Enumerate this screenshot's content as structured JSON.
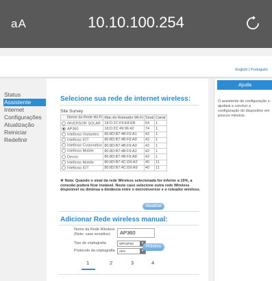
{
  "browser": {
    "text_size_label": "aA",
    "url": "10.10.100.254"
  },
  "lang_links": "English | Português",
  "nav": {
    "items": [
      {
        "label": "Status",
        "active": false
      },
      {
        "label": "Assistente",
        "active": true
      },
      {
        "label": "Internet",
        "active": false
      },
      {
        "label": "Configurações",
        "active": false
      },
      {
        "label": "Atualização",
        "active": false
      },
      {
        "label": "Reiniciar",
        "active": false
      },
      {
        "label": "Redefinir",
        "active": false
      }
    ]
  },
  "wizard": {
    "title": "Selecione sua rede de internet wireless:",
    "site_survey_label": "Site Survey",
    "table": {
      "headers": [
        "Nome da Rede Wi-Fi",
        "Mac do Roteador Wi-Fi",
        "Sinal",
        "Canal"
      ],
      "rows": [
        {
          "ssid": "INVERSOR SOLAR",
          "mac": "18:D:2C:F9:E8:EB",
          "signal": "64",
          "channel": "1",
          "selected": false
        },
        {
          "ssid": "AP360",
          "mac": "18:D:2C:49:96:42",
          "signal": "74",
          "channel": "1",
          "selected": true
        },
        {
          "ssid": "Intelbras Visitantes",
          "mac": "80:8D:B7:4B:F9:A1",
          "signal": "42",
          "channel": "1",
          "selected": false
        },
        {
          "ssid": "Intelbras IOT",
          "mac": "80:8D:B7:4B:F9:A9",
          "signal": "42",
          "channel": "1",
          "selected": false
        },
        {
          "ssid": "Intelbras Corporativo",
          "mac": "80:8D:B7:4B:F9:A0",
          "signal": "42",
          "channel": "1",
          "selected": false
        },
        {
          "ssid": "Intelbras Mobile",
          "mac": "80:8D:B7:4B:F9:A2",
          "signal": "42",
          "channel": "1",
          "selected": false
        },
        {
          "ssid": "Devon",
          "mac": "80:8D:B7:4B:F9:A8",
          "signal": "42",
          "channel": "1",
          "selected": false
        },
        {
          "ssid": "Intelbras Mobile",
          "mac": "80:8D:B7:4C:D9:A2",
          "signal": "40",
          "channel": "11",
          "selected": false
        },
        {
          "ssid": "Intelbras IOT",
          "mac": "80:8D:B7:4C:D9:A9",
          "signal": "40",
          "channel": "11",
          "selected": false
        }
      ]
    },
    "note": "★ Nota: Quando o sinal da rede Wireless selecionada for inferior a 15%, a conexão poderá ficar instável. Neste caso selecione outra rede Wireless disponível ou diminua a distância entre o microinversor e o roteador wireless.",
    "refresh_label": "Atualizar",
    "manual_title": "Adicionar Rede wireless manual:",
    "ssid_label": "Nome da Rede Wireless",
    "ssid_note": "(Note: case sensitive)",
    "ssid_value": "AP360",
    "encryption_label": "Tipo de criptografia",
    "encryption_value": "WPA2PSK",
    "protocol_label": "Protocolo da criptografia",
    "protocol_value": "AES",
    "next_label": "Próximo",
    "steps": [
      "1",
      "2",
      "3",
      "4"
    ],
    "current_step": 1
  },
  "help": {
    "title": "Ajuda",
    "text": "O assistente de configuração o ajudará a concluir a configuração do dispositivo em poucos minutos."
  },
  "colors": {
    "accent": "#2b8bd3",
    "button": "#6aa8de",
    "topbar": "#595959"
  }
}
